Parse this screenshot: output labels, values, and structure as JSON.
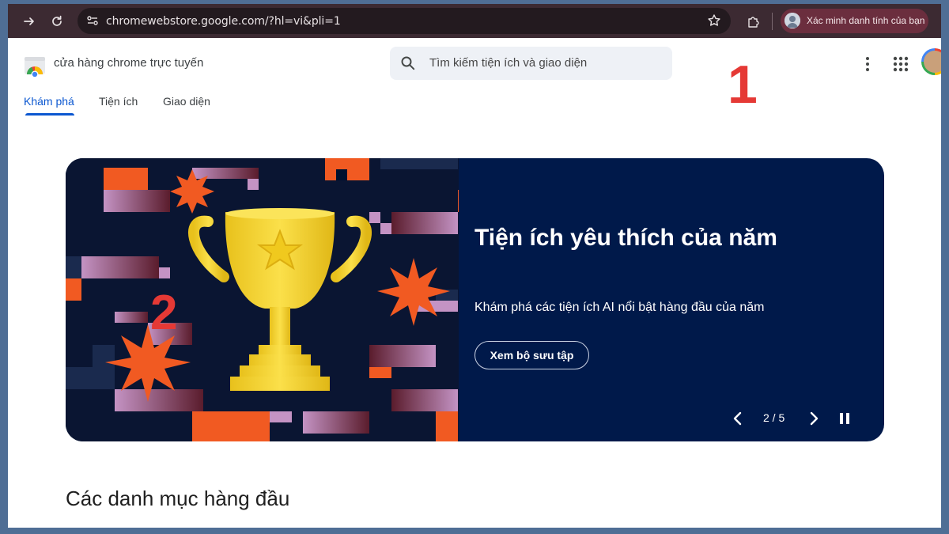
{
  "browser": {
    "url": "chromewebstore.google.com/?hl=vi&pli=1",
    "profile_label": "Xác minh danh tính của bạn",
    "icons": [
      "forward-arrow-icon",
      "reload-icon",
      "site-settings-icon",
      "bookmark-star-icon",
      "extensions-puzzle-icon"
    ]
  },
  "header": {
    "store_title": "cửa hàng chrome trực tuyến",
    "search_placeholder": "Tìm kiếm tiện ích và giao diện",
    "overlay_marker_1": "1"
  },
  "tabs": [
    {
      "label": "Khám phá",
      "active": true
    },
    {
      "label": "Tiện ích",
      "active": false
    },
    {
      "label": "Giao diện",
      "active": false
    }
  ],
  "banner": {
    "title": "Tiện ích yêu thích của năm",
    "subtitle": "Khám phá các tiện ích AI nổi bật hàng đầu của năm",
    "button_label": "Xem bộ sưu tập",
    "counter": "2 / 5",
    "overlay_marker_2": "2",
    "colors": {
      "background": "#00194a",
      "accent_orange": "#f15a22",
      "trophy": "#f5d22b"
    }
  },
  "sections": {
    "top_categories_title": "Các danh mục hàng đầu"
  }
}
